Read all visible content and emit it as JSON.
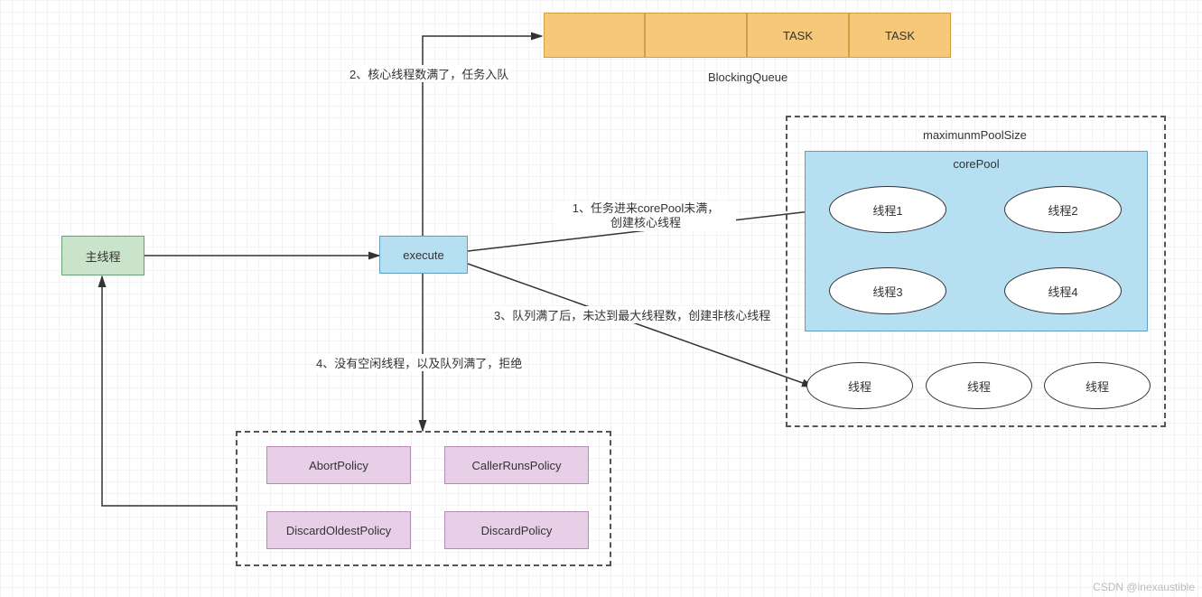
{
  "nodes": {
    "main_thread": "主线程",
    "execute": "execute",
    "queue_label": "BlockingQueue",
    "queue_cells": [
      "",
      "",
      "TASK",
      "TASK"
    ],
    "max_pool_label": "maximunmPoolSize",
    "core_pool_label": "corePool",
    "core_threads": [
      "线程1",
      "线程2",
      "线程3",
      "线程4"
    ],
    "extra_threads": [
      "线程",
      "线程",
      "线程"
    ],
    "policies": [
      "AbortPolicy",
      "CallerRunsPolicy",
      "DiscardOldestPolicy",
      "DiscardPolicy"
    ]
  },
  "edges": {
    "step1": "1、任务进来corePool未满，\n创建核心线程",
    "step2": "2、核心线程数满了，任务入队",
    "step3": "3、队列满了后，未达到最大线程数，创建非核心线程",
    "step4": "4、没有空闲线程，以及队列满了，拒绝"
  },
  "watermark": "CSDN @inexaustible"
}
